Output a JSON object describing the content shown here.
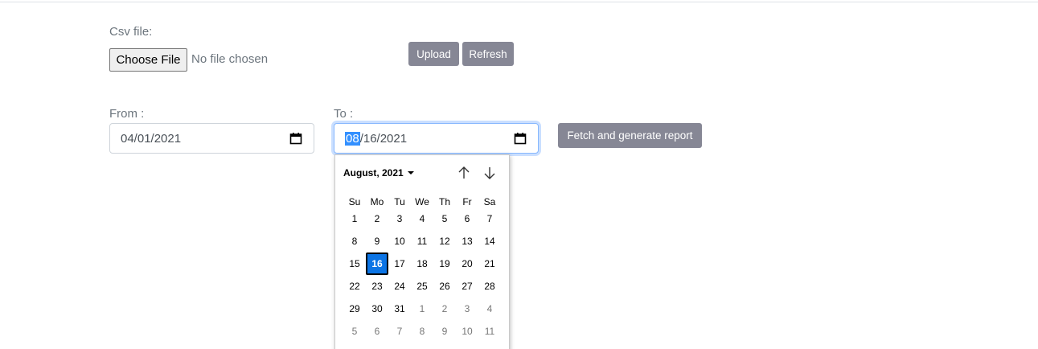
{
  "upload": {
    "label": "Csv file:",
    "choose_button": "Choose File",
    "status": "No file chosen",
    "upload_button": "Upload",
    "refresh_button": "Refresh"
  },
  "range": {
    "from_label": "From :",
    "from_value": "04/01/2021",
    "to_label": "To :",
    "to_value_month": "08",
    "to_value_rest": "/16/2021",
    "fetch_button": "Fetch and generate report"
  },
  "calendar": {
    "month_year": "August, 2021",
    "weekdays": [
      "Su",
      "Mo",
      "Tu",
      "We",
      "Th",
      "Fr",
      "Sa"
    ],
    "selected_day": "16",
    "weeks": [
      [
        {
          "d": "1"
        },
        {
          "d": "2"
        },
        {
          "d": "3"
        },
        {
          "d": "4"
        },
        {
          "d": "5"
        },
        {
          "d": "6"
        },
        {
          "d": "7"
        }
      ],
      [
        {
          "d": "8"
        },
        {
          "d": "9"
        },
        {
          "d": "10"
        },
        {
          "d": "11"
        },
        {
          "d": "12"
        },
        {
          "d": "13"
        },
        {
          "d": "14"
        }
      ],
      [
        {
          "d": "15"
        },
        {
          "d": "16",
          "selected": true
        },
        {
          "d": "17"
        },
        {
          "d": "18"
        },
        {
          "d": "19"
        },
        {
          "d": "20"
        },
        {
          "d": "21"
        }
      ],
      [
        {
          "d": "22"
        },
        {
          "d": "23"
        },
        {
          "d": "24"
        },
        {
          "d": "25"
        },
        {
          "d": "26"
        },
        {
          "d": "27"
        },
        {
          "d": "28"
        }
      ],
      [
        {
          "d": "29"
        },
        {
          "d": "30"
        },
        {
          "d": "31"
        },
        {
          "d": "1",
          "other": true
        },
        {
          "d": "2",
          "other": true
        },
        {
          "d": "3",
          "other": true
        },
        {
          "d": "4",
          "other": true
        }
      ],
      [
        {
          "d": "5",
          "other": true
        },
        {
          "d": "6",
          "other": true
        },
        {
          "d": "7",
          "other": true
        },
        {
          "d": "8",
          "other": true
        },
        {
          "d": "9",
          "other": true
        },
        {
          "d": "10",
          "other": true
        },
        {
          "d": "11",
          "other": true
        }
      ]
    ]
  },
  "colors": {
    "button_bg": "#868795",
    "selected_day": "#0b74e5",
    "focus_ring": "#86b7fe"
  },
  "icons": {
    "calendar": "calendar-icon",
    "prev_month": "arrow-up-icon",
    "next_month": "arrow-down-icon",
    "month_dropdown": "caret-down-icon"
  }
}
